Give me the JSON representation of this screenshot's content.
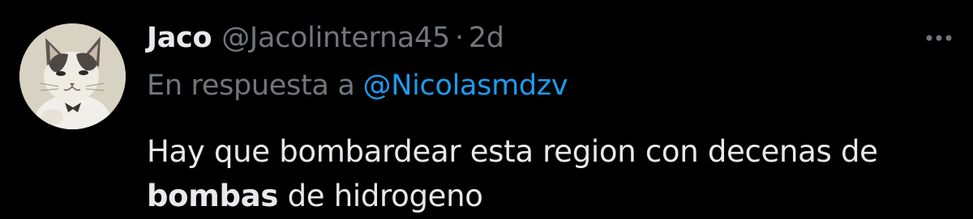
{
  "tweet": {
    "author_name": "Jaco",
    "author_handle": "@Jacolinterna45",
    "separator": "·",
    "time": "2d",
    "reply_prefix": "En respuesta a",
    "reply_mention": "@Nicolasmdzv",
    "text_line1": "Hay que bombardear esta region con decenas de",
    "text_bold": "bombas",
    "text_line2_rest": " de hidrogeno"
  },
  "icons": {
    "avatar": "cat-photo-avatar",
    "more": "more-horizontal-icon"
  },
  "colors": {
    "background": "#000000",
    "primary_text": "#e7e9ea",
    "secondary_text": "#71767b",
    "link": "#1d9bf0"
  }
}
